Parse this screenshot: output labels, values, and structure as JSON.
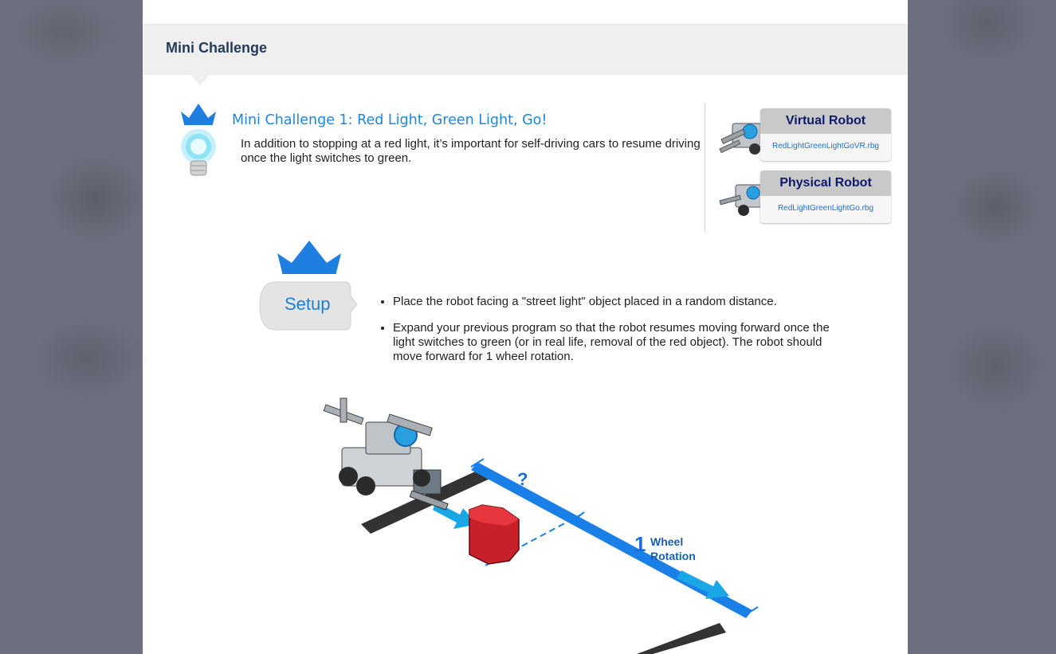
{
  "section": {
    "title": "Mini Challenge"
  },
  "challenge": {
    "title": "Mini Challenge 1: Red Light, Green Light, Go!",
    "description": "In addition to stopping at a red light, it’s important for self-driving cars to resume driving once the light switches to green."
  },
  "cards": [
    {
      "title": "Virtual Robot",
      "file": "RedLightGreenLightGoVR.rbg"
    },
    {
      "title": "Physical Robot",
      "file": "RedLightGreenLightGo.rbg"
    }
  ],
  "setup": {
    "label": "Setup",
    "items": [
      "Place the robot facing a \"street light\" object placed in a random distance.",
      "Expand your previous program so that the robot resumes moving forward once the light switches to green (or in real life, removal of the red object). The robot should move forward for 1 wheel rotation."
    ]
  },
  "illustration": {
    "unknown_label": "?",
    "distance_number": "1",
    "distance_text_line1": "Wheel",
    "distance_text_line2": "Rotation"
  },
  "colors": {
    "accent_blue": "#1f86e0",
    "header_bg": "#efefef",
    "title_text": "#243c5a",
    "red_object": "#c8202a"
  }
}
